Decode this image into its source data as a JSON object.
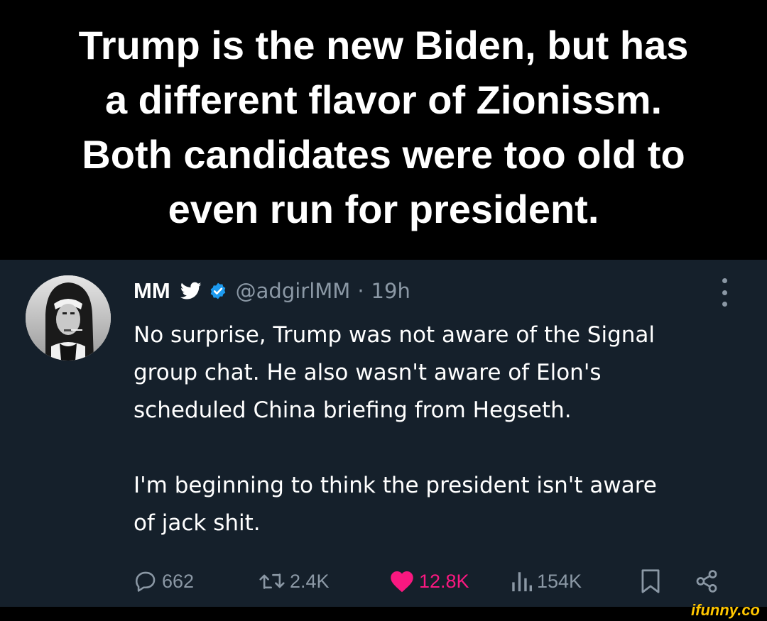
{
  "caption": {
    "lines": [
      "Trump is the new Biden, but has",
      "a different flavor of Zionissm.",
      "Both candidates were too old to",
      "even run for president."
    ]
  },
  "tweet": {
    "name": "MM",
    "handle": "@adgirlMM",
    "separator": "·",
    "time": "19h",
    "paragraphs": [
      [
        "No surprise, Trump was not aware of the Signal",
        "group chat. He also wasn't aware of Elon's",
        "scheduled China briefing from Hegseth."
      ],
      [
        "I'm beginning to think the president isn't aware",
        "of jack shit."
      ]
    ],
    "actions": {
      "replies": "662",
      "retweets": "2.4K",
      "likes": "12.8K",
      "views": "154K"
    }
  },
  "icons": {
    "bird": "twitter-bird-icon",
    "verified": "verified-badge-icon",
    "more": "more-options-icon",
    "reply": "reply-icon",
    "retweet": "retweet-icon",
    "like": "heart-icon",
    "views": "views-icon",
    "bookmark": "bookmark-icon",
    "share": "share-icon"
  },
  "colors": {
    "caption_bg": "#000000",
    "tweet_bg": "#15202b",
    "text": "#ffffff",
    "muted": "#8b98a5",
    "like": "#f91880",
    "verified": "#1d9bf0",
    "watermark": "#ffc600"
  },
  "watermark": "ifunny.co"
}
